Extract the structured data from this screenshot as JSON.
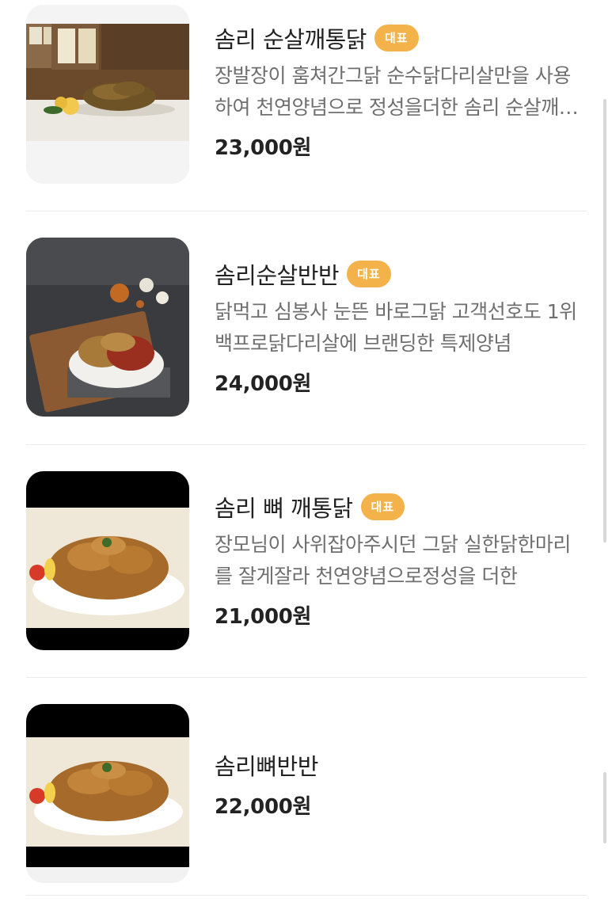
{
  "items": [
    {
      "name": "솜리 순살깨통닭",
      "badge": "대표",
      "description": "장발장이 훔쳐간그닭 순수닭다리살만을 사용하여 천연양념으로 정성을더한 솜리 순살깨통닭",
      "price": "23,000원",
      "image_icon": "fried-chicken-plate-image"
    },
    {
      "name": "솜리순살반반",
      "badge": "대표",
      "description": "닭먹고 심봉사 눈뜬 바로그닭 고객선호도 1위 백프로닭다리살에 브랜딩한 특제양념",
      "price": "24,000원",
      "image_icon": "half-half-chicken-platter-image"
    },
    {
      "name": "솜리 뼈 깨통닭",
      "badge": "대표",
      "description": "장모님이 사위잡아주시던 그닭 실한닭한마리를 잘게잘라 천연양념으로정성을 더한",
      "price": "21,000원",
      "image_icon": "bone-in-chicken-plate-image"
    },
    {
      "name": "솜리뼈반반",
      "badge": "",
      "description": "",
      "price": "22,000원",
      "image_icon": "bone-in-half-half-chicken-image"
    }
  ],
  "colors": {
    "badge": "#f3b24a",
    "description": "#6f6f6f",
    "divider": "#ececec"
  }
}
